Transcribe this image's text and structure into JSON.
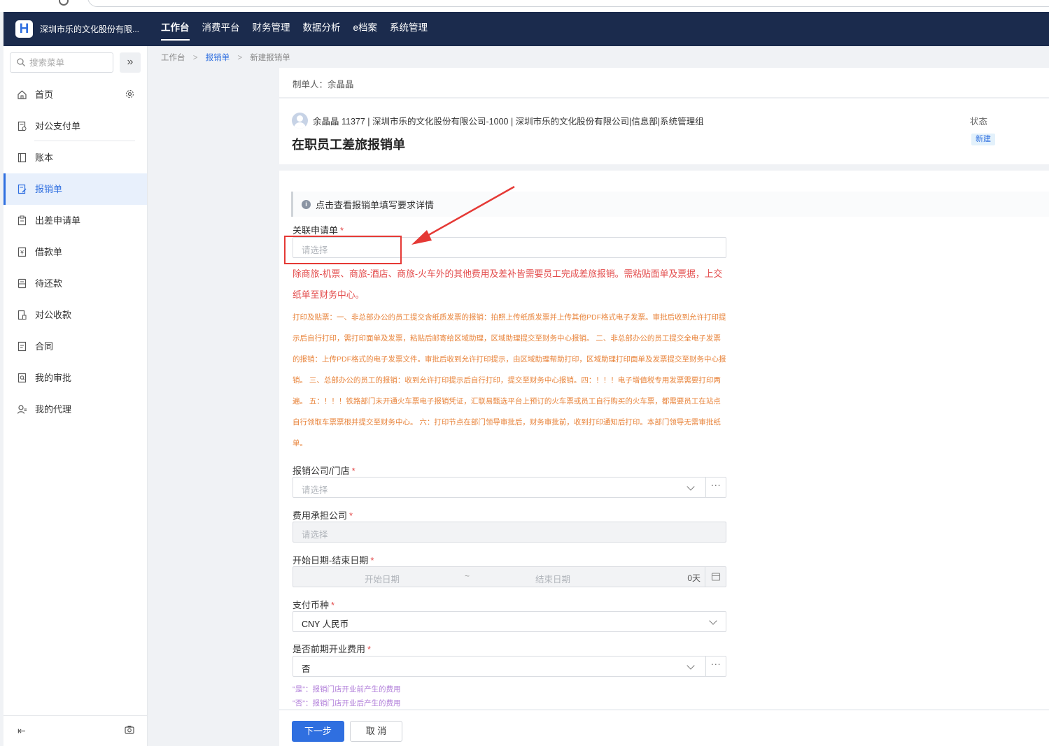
{
  "topbar": {
    "logo_text": "H",
    "company": "深圳市乐的文化股份有限...",
    "nav": [
      "工作台",
      "消费平台",
      "财务管理",
      "数据分析",
      "e档案",
      "系统管理"
    ],
    "active_nav": "工作台",
    "bg_color": "#1b2b4d"
  },
  "sidebar": {
    "search_placeholder": "搜索菜单",
    "collapse_icon": "double-chevron-right-icon",
    "items": [
      {
        "label": "首页",
        "icon": "home-icon"
      },
      {
        "label": "对公支付单",
        "icon": "payment-doc-icon"
      },
      {
        "label": "账本",
        "icon": "ledger-icon"
      },
      {
        "label": "报销单",
        "icon": "reimbursement-icon"
      },
      {
        "label": "出差申请单",
        "icon": "clipboard-icon"
      },
      {
        "label": "借款单",
        "icon": "yen-doc-icon"
      },
      {
        "label": "待还款",
        "icon": "repay-icon"
      },
      {
        "label": "对公收款",
        "icon": "receipt-icon"
      },
      {
        "label": "合同",
        "icon": "contract-icon"
      },
      {
        "label": "我的审批",
        "icon": "approval-icon"
      },
      {
        "label": "我的代理",
        "icon": "agent-icon"
      }
    ],
    "active_item": "报销单",
    "accent_color": "#2f6fe0"
  },
  "breadcrumb": {
    "home": "工作台",
    "section": "报销单",
    "current": "新建报销单"
  },
  "creator": "制单人：余晶晶",
  "header": {
    "user_info": "余晶晶 11377 | 深圳市乐的文化股份有限公司-1000 | 深圳市乐的文化股份有限公司|信息部|系统管理组",
    "title": "在职员工差旅报销单",
    "status_label": "状态",
    "status_value": "新建"
  },
  "form": {
    "notice": "点击查看报销单填写要求详情",
    "related_app": {
      "label": "关联申请单",
      "placeholder": "请选择"
    },
    "red_note": "除商旅-机票、商旅-酒店、商旅-火车外的其他费用及差补皆需要员工完成差旅报销。需粘贴面单及票据，上交纸单至财务中心。",
    "orange_note": "打印及贴票：一、非总部办公的员工提交含纸质发票的报销：拍照上传纸质发票并上传其他PDF格式电子发票。审批后收到允许打印提示后自行打印，需打印面单及发票，粘贴后邮寄给区域助理，区域助理提交至财务中心报销。 二、非总部办公的员工提交全电子发票的报销：上传PDF格式的电子发票文件。审批后收到允许打印提示，由区域助理帮助打印，区域助理打印面单及发票提交至财务中心报销。 三、总部办公的员工的报销：收到允许打印提示后自行打印，提交至财务中心报销。四：！！！电子增值税专用发票需要打印两遍。 五：！！！铁路部门未开通火车票电子报销凭证，汇联易甄选平台上预订的火车票或员工自行购买的火车票，都需要员工在站点自行领取车票票根并提交至财务中心。 六：打印节点在部门领导审批后，财务审批前，收到打印通知后打印。本部门领导无需审批纸单。",
    "company": {
      "label": "报销公司/门店",
      "placeholder": "请选择",
      "more": "···"
    },
    "cost_company": {
      "label": "费用承担公司",
      "placeholder": "请选择"
    },
    "date_range": {
      "label": "开始日期-结束日期",
      "start_placeholder": "开始日期",
      "separator": "~",
      "end_placeholder": "结束日期",
      "days": "0天"
    },
    "currency": {
      "label": "支付币种",
      "value": "CNY 人民币"
    },
    "pre_opening": {
      "label": "是否前期开业费用",
      "value": "否",
      "more": "···"
    },
    "hint_yes": "\"是\"：报销门店开业前产生的费用",
    "hint_no": "\"否\"：报销门店开业后产生的费用",
    "required_mark": "*"
  },
  "footer": {
    "next": "下一步",
    "cancel": "取 消"
  },
  "annotation_color": "#e53935"
}
